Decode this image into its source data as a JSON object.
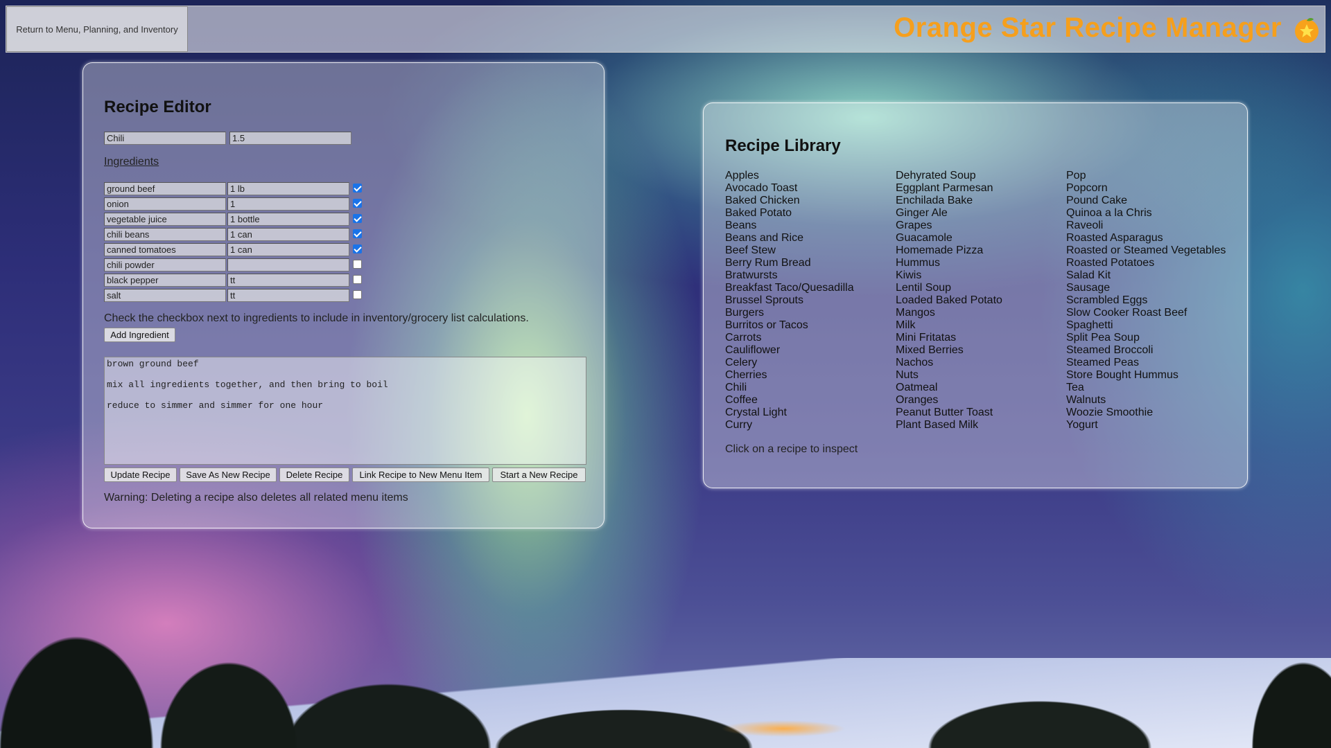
{
  "header": {
    "back_label": "Return to Menu, Planning, and Inventory",
    "title": "Orange Star Recipe Manager",
    "icon": "orange-star-icon"
  },
  "editor": {
    "title": "Recipe Editor",
    "recipe_name": "Chili",
    "servings": "1.5",
    "ingredients_label": "Ingredients",
    "ingredients": [
      {
        "name": "ground beef",
        "qty": "1 lb",
        "checked": true
      },
      {
        "name": "onion",
        "qty": "1",
        "checked": true
      },
      {
        "name": "vegetable juice",
        "qty": "1 bottle",
        "checked": true
      },
      {
        "name": "chili beans",
        "qty": "1 can",
        "checked": true
      },
      {
        "name": "canned tomatoes",
        "qty": "1 can",
        "checked": true
      },
      {
        "name": "chili powder",
        "qty": "",
        "checked": false
      },
      {
        "name": "black pepper",
        "qty": "tt",
        "checked": false
      },
      {
        "name": "salt",
        "qty": "tt",
        "checked": false
      }
    ],
    "hint": "Check the checkbox next to ingredients to include in inventory/grocery list calculations.",
    "add_ingredient": "Add Ingredient",
    "instructions": [
      "brown ground beef",
      "mix all ingredients together, and then bring to boil",
      "reduce to simmer and simmer for one hour"
    ],
    "buttons": {
      "update": "Update Recipe",
      "save_new": "Save As New Recipe",
      "delete": "Delete Recipe",
      "link": "Link Recipe to New Menu Item",
      "start_new": "Start a New Recipe"
    },
    "warning": "Warning: Deleting a recipe also deletes all related menu items"
  },
  "library": {
    "title": "Recipe Library",
    "columns": [
      [
        "Apples",
        "Avocado Toast",
        "Baked Chicken",
        "Baked Potato",
        "Beans",
        "Beans and Rice",
        "Beef Stew",
        "Berry Rum Bread",
        "Bratwursts",
        "Breakfast Taco/Quesadilla",
        "Brussel Sprouts",
        "Burgers",
        "Burritos or Tacos",
        "Carrots",
        "Cauliflower",
        "Celery",
        "Cherries",
        "Chili",
        "Coffee",
        "Crystal Light",
        "Curry"
      ],
      [
        "Dehyrated Soup",
        "Eggplant Parmesan",
        "Enchilada Bake",
        "Ginger Ale",
        "Grapes",
        "Guacamole",
        "Homemade Pizza",
        "Hummus",
        "Kiwis",
        "Lentil Soup",
        "Loaded Baked Potato",
        "Mangos",
        "Milk",
        "Mini Fritatas",
        "Mixed Berries",
        "Nachos",
        "Nuts",
        "Oatmeal",
        "Oranges",
        "Peanut Butter Toast",
        "Plant Based Milk"
      ],
      [
        "Pop",
        "Popcorn",
        "Pound Cake",
        "Quinoa a la Chris",
        "Raveoli",
        "Roasted Asparagus",
        "Roasted or Steamed Vegetables",
        "Roasted Potatoes",
        "Salad Kit",
        "Sausage",
        "Scrambled Eggs",
        "Slow Cooker Roast Beef",
        "Spaghetti",
        "Split Pea Soup",
        "Steamed Broccoli",
        "Steamed Peas",
        "Store Bought Hummus",
        "Tea",
        "Walnuts",
        "Woozie Smoothie",
        "Yogurt"
      ]
    ],
    "hint": "Click on a recipe to inspect"
  },
  "colors": {
    "title_orange": "#f59f1d",
    "checkbox_blue": "#1a73e8"
  }
}
